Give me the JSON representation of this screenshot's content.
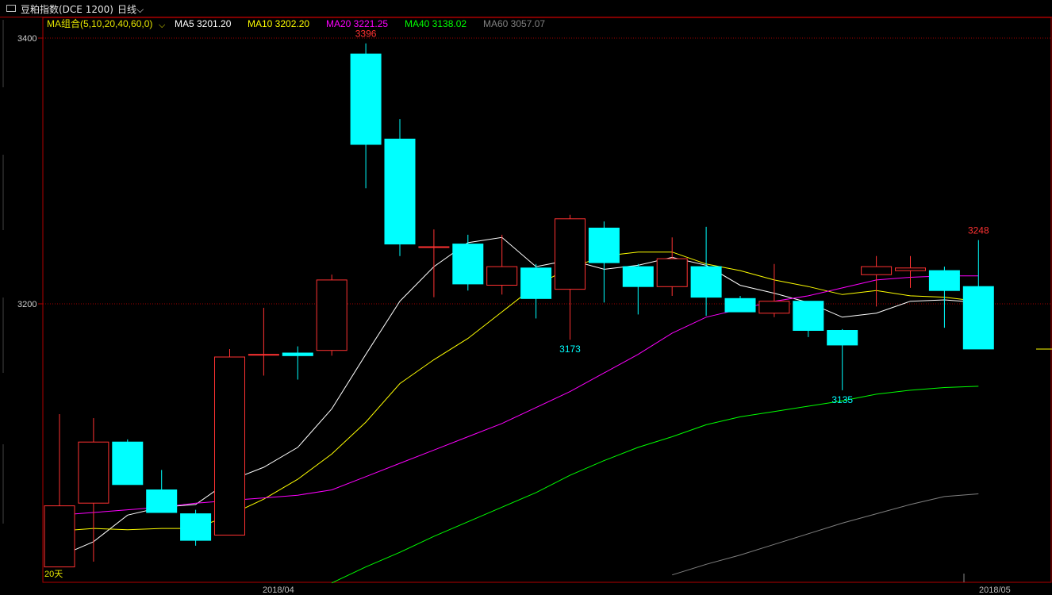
{
  "title_bar": {
    "instrument": "豆粕指数(DCE 1200)",
    "period": "日线"
  },
  "legend": {
    "group_label": "MA组合(5,10,20,40,60,0)",
    "items": [
      {
        "label": "MA5 3201.20",
        "color": "#ffffff"
      },
      {
        "label": "MA10 3202.20",
        "color": "#ffff00"
      },
      {
        "label": "MA20 3221.25",
        "color": "#ff00ff"
      },
      {
        "label": "MA40 3138.02",
        "color": "#00ff00"
      },
      {
        "label": "MA60 3057.07",
        "color": "#808080"
      }
    ]
  },
  "colors": {
    "up": "#ff3232",
    "down": "#00ffff",
    "border": "#b00000",
    "group_label": "#e6e600"
  },
  "chart_data": {
    "type": "candlestick",
    "y_ticks": [
      "3400",
      "3200"
    ],
    "x_ticks": [
      "2018/04",
      "2018/05"
    ],
    "ylim": [
      2994,
      3412
    ],
    "candles": [
      {
        "open": 3002,
        "high": 3117,
        "low": 3002,
        "close": 3048
      },
      {
        "open": 3050,
        "high": 3114,
        "low": 3006,
        "close": 3096
      },
      {
        "open": 3096,
        "high": 3098,
        "low": 3064,
        "close": 3064
      },
      {
        "open": 3060,
        "high": 3075,
        "low": 3047,
        "close": 3043
      },
      {
        "open": 3042,
        "high": 3045,
        "low": 3018,
        "close": 3022
      },
      {
        "open": 3026,
        "high": 3166,
        "low": 3026,
        "close": 3160
      },
      {
        "open": 3162,
        "high": 3197,
        "low": 3146,
        "close": 3162
      },
      {
        "open": 3163,
        "high": 3168,
        "low": 3143,
        "close": 3161
      },
      {
        "open": 3165,
        "high": 3222,
        "low": 3161,
        "close": 3218
      },
      {
        "open": 3388,
        "high": 3396,
        "low": 3287,
        "close": 3320
      },
      {
        "open": 3324,
        "high": 3339,
        "low": 3236,
        "close": 3245
      },
      {
        "open": 3243,
        "high": 3256,
        "low": 3205,
        "close": 3243
      },
      {
        "open": 3245,
        "high": 3252,
        "low": 3210,
        "close": 3215
      },
      {
        "open": 3214,
        "high": 3252,
        "low": 3207,
        "close": 3228
      },
      {
        "open": 3227,
        "high": 3230,
        "low": 3189,
        "close": 3204
      },
      {
        "open": 3211,
        "high": 3267,
        "low": 3173,
        "close": 3264
      },
      {
        "open": 3257,
        "high": 3262,
        "low": 3201,
        "close": 3231
      },
      {
        "open": 3228,
        "high": 3230,
        "low": 3192,
        "close": 3213
      },
      {
        "open": 3213,
        "high": 3250,
        "low": 3206,
        "close": 3234
      },
      {
        "open": 3228,
        "high": 3258,
        "low": 3191,
        "close": 3205
      },
      {
        "open": 3204,
        "high": 3206,
        "low": 3194,
        "close": 3194
      },
      {
        "open": 3193,
        "high": 3230,
        "low": 3190,
        "close": 3202
      },
      {
        "open": 3202,
        "high": 3202,
        "low": 3175,
        "close": 3180
      },
      {
        "open": 3180,
        "high": 3181,
        "low": 3135,
        "close": 3169
      },
      {
        "open": 3222,
        "high": 3236,
        "low": 3198,
        "close": 3228
      },
      {
        "open": 3225,
        "high": 3236,
        "low": 3212,
        "close": 3227
      },
      {
        "open": 3225,
        "high": 3228,
        "low": 3182,
        "close": 3210
      },
      {
        "open": 3213,
        "high": 3248,
        "low": 3166,
        "close": 3166
      }
    ],
    "ma_series": [
      {
        "name": "MA5",
        "color": "#ffffff",
        "values": [
          3010,
          3021,
          3041,
          3047,
          3049,
          3067,
          3077,
          3092,
          3121,
          3162,
          3202,
          3228,
          3246,
          3250,
          3228,
          3233,
          3226,
          3229,
          3235,
          3229,
          3214,
          3208,
          3201,
          3190,
          3193,
          3202,
          3203,
          3201
        ]
      },
      {
        "name": "MA10",
        "color": "#ffff00",
        "values": [
          3029,
          3031,
          3030,
          3031,
          3031,
          3041,
          3053,
          3068,
          3087,
          3111,
          3140,
          3158,
          3174,
          3194,
          3214,
          3227,
          3236,
          3239,
          3239,
          3230,
          3225,
          3218,
          3213,
          3207,
          3210,
          3206,
          3205,
          3202
        ]
      },
      {
        "name": "MA20",
        "color": "#ff00ff",
        "values": [
          3041,
          3043,
          3045,
          3047,
          3050,
          3052,
          3054,
          3056,
          3060,
          3070,
          3080,
          3090,
          3100,
          3110,
          3122,
          3134,
          3148,
          3162,
          3178,
          3190,
          3196,
          3202,
          3206,
          3212,
          3218,
          3220,
          3221,
          3221
        ]
      },
      {
        "name": "MA40",
        "color": "#00ff00",
        "values": [
          null,
          null,
          null,
          null,
          null,
          null,
          null,
          null,
          2990,
          3002,
          3013,
          3025,
          3036,
          3047,
          3058,
          3071,
          3082,
          3092,
          3100,
          3109,
          3115,
          3119,
          3123,
          3127,
          3132,
          3135,
          3137,
          3138
        ]
      },
      {
        "name": "MA60",
        "color": "#808080",
        "values": [
          null,
          null,
          null,
          null,
          null,
          null,
          null,
          null,
          null,
          null,
          null,
          null,
          null,
          null,
          null,
          null,
          null,
          null,
          2996,
          3004,
          3011,
          3019,
          3027,
          3035,
          3042,
          3049,
          3055,
          3057
        ]
      }
    ],
    "annotations": [
      {
        "text": "3396",
        "candle": 9,
        "price": 3396,
        "anchor": "above",
        "color": "#ff3232"
      },
      {
        "text": "3173",
        "candle": 15,
        "price": 3173,
        "anchor": "below",
        "color": "#00ffff"
      },
      {
        "text": "3135",
        "candle": 23,
        "price": 3135,
        "anchor": "below",
        "color": "#00ffff"
      },
      {
        "text": "3248",
        "candle": 27,
        "price": 3248,
        "anchor": "above",
        "color": "#ff3232"
      }
    ],
    "corner_label": "20天",
    "grid": true
  }
}
